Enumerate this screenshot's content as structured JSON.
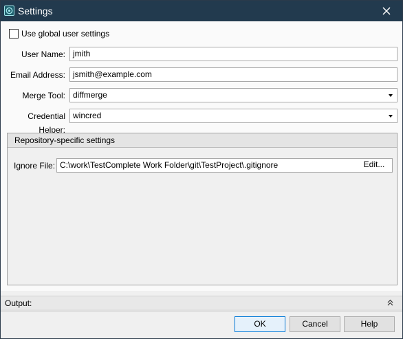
{
  "window": {
    "title": "Settings"
  },
  "global": {
    "checkbox_label": "Use global user settings",
    "checked": false
  },
  "form": {
    "user_name_label": "User Name:",
    "user_name_value": "jmith",
    "email_label": "Email Address:",
    "email_value": "jsmith@example.com",
    "merge_tool_label": "Merge Tool:",
    "merge_tool_value": "diffmerge",
    "credential_label": "Credential Helper:",
    "credential_value": "wincred"
  },
  "repo": {
    "header": "Repository-specific settings",
    "ignore_label": "Ignore File:",
    "ignore_value": "C:\\work\\TestComplete Work Folder\\git\\TestProject\\.gitignore",
    "edit_label": "Edit..."
  },
  "output": {
    "label": "Output:"
  },
  "footer": {
    "ok_label": "OK",
    "cancel_label": "Cancel",
    "help_label": "Help"
  },
  "icons": {
    "app": "app-logo-icon",
    "close": "close-icon",
    "collapse": "double-chevron-up-icon",
    "dropdown": "chevron-down-icon"
  },
  "colors": {
    "titlebar": "#223a4e",
    "accent": "#0078d7"
  }
}
